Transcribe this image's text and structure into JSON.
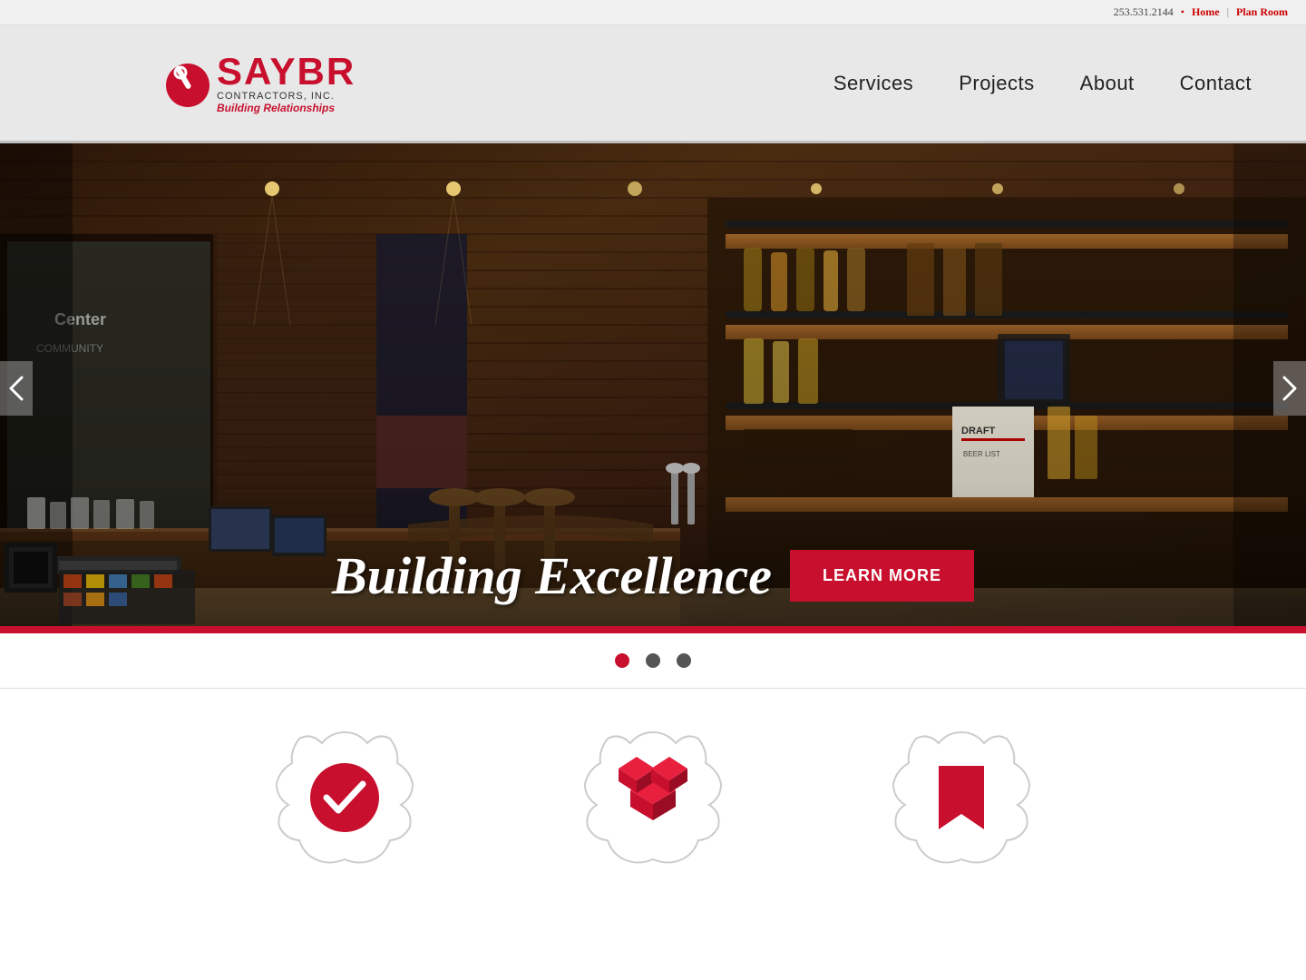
{
  "topbar": {
    "phone": "253.531.2144",
    "dot": "•",
    "home_label": "Home",
    "separator": "|",
    "planroom_label": "Plan Room"
  },
  "header": {
    "logo": {
      "company_name": "SAYBR",
      "subtitle": "CONTRACTORS, INC.",
      "tagline": "Building Relationships"
    },
    "nav": {
      "items": [
        {
          "label": "Services",
          "href": "#"
        },
        {
          "label": "Projects",
          "href": "#"
        },
        {
          "label": "About",
          "href": "#"
        },
        {
          "label": "Contact",
          "href": "#"
        }
      ]
    }
  },
  "hero": {
    "title": "Building Excellence",
    "cta_label": "LEARN MORE",
    "dots": [
      {
        "active": true
      },
      {
        "active": false
      },
      {
        "active": false
      }
    ]
  },
  "icons": [
    {
      "name": "checkmark-icon",
      "symbol": "✔"
    },
    {
      "name": "blocks-icon",
      "symbol": "⬡"
    },
    {
      "name": "bookmark-icon",
      "symbol": "🔖"
    }
  ],
  "colors": {
    "brand_red": "#c8102e",
    "dark_text": "#222",
    "topbar_bg": "#f0f0f0"
  }
}
